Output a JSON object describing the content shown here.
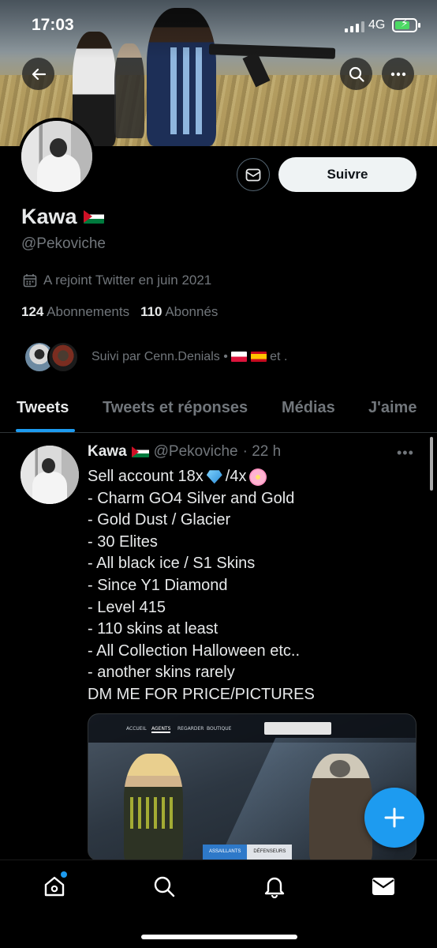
{
  "status_bar": {
    "time": "17:03",
    "network": "4G"
  },
  "profile": {
    "display_name": "Kawa",
    "handle": "@Pekoviche",
    "joined": "A rejoint Twitter en juin 2021",
    "following_count": "124",
    "following_label": "Abonnements",
    "followers_count": "110",
    "followers_label": "Abonnés",
    "followed_by_text": "Suivi par Cenn.Denials •",
    "followed_by_suffix": "et ."
  },
  "actions": {
    "follow_label": "Suivre"
  },
  "tabs": [
    {
      "label": "Tweets",
      "active": true
    },
    {
      "label": "Tweets et réponses",
      "active": false
    },
    {
      "label": "Médias",
      "active": false
    },
    {
      "label": "J'aime",
      "active": false
    }
  ],
  "tweet": {
    "author": "Kawa",
    "handle": "@Pekoviche",
    "time": "· 22 h",
    "lines": [
      "Sell account 18x",
      "/4x",
      "- Charm GO4 Silver and Gold",
      "- Gold Dust / Glacier",
      "- 30 Elites",
      "- All black ice / S1 Skins",
      "- Since Y1 Diamond",
      "- Level 415",
      "- 110 skins at least",
      "- All Collection Halloween etc..",
      "- another skins rarely",
      "DM ME FOR PRICE/PICTURES"
    ],
    "media": {
      "tabs": [
        "ACCUEIL",
        "AGENTS",
        "REGARDER",
        "BOUTIQUE"
      ],
      "attackers": "ASSAILLANTS",
      "defenders": "DÉFENSEURS"
    }
  },
  "colors": {
    "accent": "#1d9bf0",
    "background": "#000000",
    "muted_text": "#71767b"
  },
  "icons": [
    "back-arrow-icon",
    "search-icon",
    "more-icon",
    "mail-icon",
    "calendar-icon",
    "compose-plus-icon",
    "home-icon",
    "explore-search-icon",
    "notifications-bell-icon",
    "messages-envelope-icon"
  ]
}
